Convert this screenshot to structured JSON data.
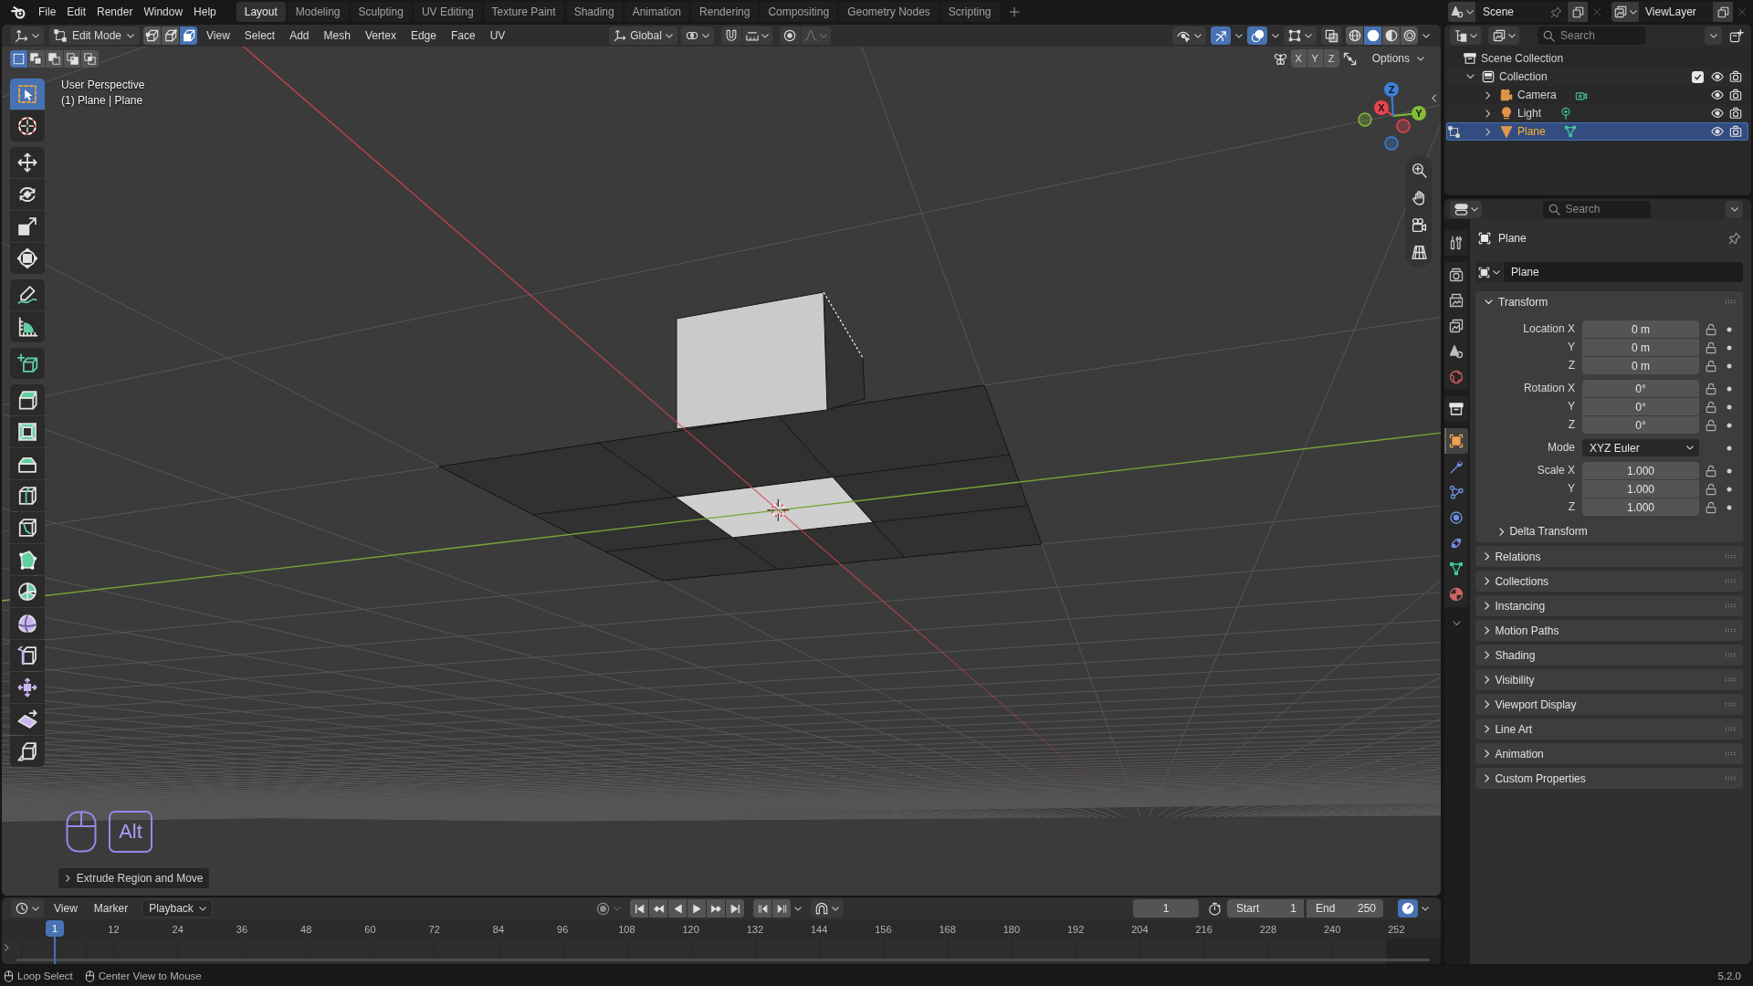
{
  "topbar": {
    "menus": [
      "File",
      "Edit",
      "Render",
      "Window",
      "Help"
    ],
    "workspaces": [
      {
        "label": "Layout",
        "selected": true
      },
      {
        "label": "Modeling",
        "selected": false
      },
      {
        "label": "Sculpting",
        "selected": false
      },
      {
        "label": "UV Editing",
        "selected": false
      },
      {
        "label": "Texture Paint",
        "selected": false
      },
      {
        "label": "Shading",
        "selected": false
      },
      {
        "label": "Animation",
        "selected": false
      },
      {
        "label": "Rendering",
        "selected": false
      },
      {
        "label": "Compositing",
        "selected": false
      },
      {
        "label": "Geometry Nodes",
        "selected": false
      },
      {
        "label": "Scripting",
        "selected": false
      }
    ],
    "scene": "Scene",
    "view_layer": "ViewLayer"
  },
  "viewport": {
    "header": {
      "mode": "Edit Mode",
      "select_modes": [
        {
          "kind": "vertex",
          "selected": false
        },
        {
          "kind": "edge",
          "selected": false
        },
        {
          "kind": "face",
          "selected": true
        }
      ],
      "menus": [
        "View",
        "Select",
        "Add",
        "Mesh",
        "Vertex",
        "Edge",
        "Face",
        "UV"
      ],
      "orientation": "Global",
      "toggles": [
        {
          "kind": "gizmo",
          "on": true
        },
        {
          "kind": "overlay",
          "on": true
        },
        {
          "kind": "xray",
          "on": false
        }
      ],
      "shading": [
        {
          "kind": "wireframe",
          "selected": false
        },
        {
          "kind": "solid",
          "selected": true
        },
        {
          "kind": "material",
          "selected": false
        },
        {
          "kind": "rendered",
          "selected": false
        }
      ]
    },
    "tool_settings": {
      "selection_ops": [
        {
          "kind": "set",
          "selected": true
        },
        {
          "kind": "extend",
          "selected": false
        },
        {
          "kind": "subtract",
          "selected": false
        },
        {
          "kind": "invert",
          "selected": false
        },
        {
          "kind": "intersect",
          "selected": false
        }
      ],
      "mirror": [
        {
          "label": "X",
          "on": false
        },
        {
          "label": "Y",
          "on": false
        },
        {
          "label": "Z",
          "on": false
        }
      ],
      "options": "Options"
    },
    "overlay_text": [
      "User Perspective",
      "(1) Plane | Plane"
    ],
    "toolbar": [
      {
        "tools": [
          {
            "kind": "select",
            "selected": true
          },
          {
            "kind": "cursor",
            "selected": false
          }
        ]
      },
      {
        "tools": [
          {
            "kind": "move",
            "selected": false
          },
          {
            "kind": "rotate",
            "selected": false
          },
          {
            "kind": "scale",
            "selected": false
          },
          {
            "kind": "transform",
            "selected": false
          }
        ]
      },
      {
        "tools": [
          {
            "kind": "annotate",
            "selected": false
          },
          {
            "kind": "measure",
            "selected": false
          }
        ]
      },
      {
        "tools": [
          {
            "kind": "addcube",
            "selected": false
          }
        ]
      },
      {
        "tools": [
          {
            "kind": "extrude",
            "selected": false
          },
          {
            "kind": "inset",
            "selected": false
          },
          {
            "kind": "bevel",
            "selected": false
          },
          {
            "kind": "loopcut",
            "selected": false
          },
          {
            "kind": "knife",
            "selected": false
          },
          {
            "kind": "polybuild",
            "selected": false
          },
          {
            "kind": "spin",
            "selected": false
          },
          {
            "kind": "smooth",
            "selected": false
          },
          {
            "kind": "slide",
            "selected": false
          },
          {
            "kind": "shrink",
            "selected": false
          },
          {
            "kind": "shear",
            "selected": false
          },
          {
            "kind": "rip",
            "selected": false
          }
        ]
      }
    ],
    "gizmo_axes": [
      {
        "label": "X",
        "color": "#e8434f"
      },
      {
        "label": "Y",
        "color": "#84bd38"
      },
      {
        "label": "Z",
        "color": "#3d7fdd"
      }
    ],
    "input_hint": {
      "key": "Alt"
    },
    "last_operator": {
      "label": "Extrude Region and Move",
      "expanded": false
    }
  },
  "timeline": {
    "menus": [
      "View",
      "Marker"
    ],
    "playback": "Playback",
    "auto_keying": false,
    "current_frame": "1",
    "start": {
      "label": "Start",
      "value": "1"
    },
    "end": {
      "label": "End",
      "value": "250"
    },
    "playhead": "1",
    "ruler": [
      "12",
      "24",
      "36",
      "48",
      "60",
      "72",
      "84",
      "96",
      "108",
      "120",
      "132",
      "144",
      "156",
      "168",
      "180",
      "192",
      "204",
      "216",
      "228",
      "240",
      "252"
    ]
  },
  "outliner": {
    "search": {
      "placeholder": "Search"
    },
    "tree": [
      {
        "label": "Scene Collection",
        "kind": "scene",
        "selected": false,
        "children": [
          {
            "label": "Collection",
            "kind": "collection",
            "selected": false,
            "expanded": true,
            "checked": true,
            "visible": true,
            "renderable": true,
            "children": [
              {
                "label": "Camera",
                "kind": "camera",
                "selected": false,
                "expanded": false,
                "editing": false,
                "visible": true,
                "renderable": true
              },
              {
                "label": "Light",
                "kind": "light",
                "selected": false,
                "expanded": false,
                "editing": false,
                "visible": true,
                "renderable": true
              },
              {
                "label": "Plane",
                "kind": "mesh",
                "selected": true,
                "expanded": false,
                "editing": true,
                "visible": true,
                "renderable": true
              }
            ]
          }
        ]
      }
    ]
  },
  "properties": {
    "search": {
      "placeholder": "Search"
    },
    "tab_groups": [
      {
        "tabs": [
          {
            "kind": "tool",
            "selected": false
          }
        ]
      },
      {
        "tabs": [
          {
            "kind": "render",
            "selected": false
          },
          {
            "kind": "output",
            "selected": false
          },
          {
            "kind": "viewlayer",
            "selected": false
          },
          {
            "kind": "scene",
            "selected": false
          },
          {
            "kind": "world",
            "selected": false
          }
        ]
      },
      {
        "tabs": [
          {
            "kind": "collection",
            "selected": false
          }
        ]
      },
      {
        "tabs": [
          {
            "kind": "object",
            "selected": true
          },
          {
            "kind": "modifiers",
            "selected": false
          },
          {
            "kind": "particles",
            "selected": false
          },
          {
            "kind": "physics",
            "selected": false
          },
          {
            "kind": "constraints",
            "selected": false
          },
          {
            "kind": "data",
            "selected": false
          },
          {
            "kind": "material",
            "selected": false
          }
        ]
      }
    ],
    "context": "Plane",
    "object_name": "Plane",
    "transform": {
      "label": "Transform",
      "expanded": true,
      "groups": [
        {
          "rows": [
            {
              "kind": "number",
              "label": "Location X",
              "value": "0 m",
              "locked": false
            },
            {
              "kind": "number",
              "label": "Y",
              "value": "0 m",
              "locked": false
            },
            {
              "kind": "number",
              "label": "Z",
              "value": "0 m",
              "locked": false
            }
          ]
        },
        {
          "rows": [
            {
              "kind": "number",
              "label": "Rotation X",
              "value": "0°",
              "locked": false
            },
            {
              "kind": "number",
              "label": "Y",
              "value": "0°",
              "locked": false
            },
            {
              "kind": "number",
              "label": "Z",
              "value": "0°",
              "locked": false
            }
          ]
        },
        {
          "rows": [
            {
              "kind": "dropdown",
              "label": "Mode",
              "value": "XYZ Euler"
            }
          ]
        },
        {
          "rows": [
            {
              "kind": "number",
              "label": "Scale X",
              "value": "1.000",
              "locked": false
            },
            {
              "kind": "number",
              "label": "Y",
              "value": "1.000",
              "locked": false
            },
            {
              "kind": "number",
              "label": "Z",
              "value": "1.000",
              "locked": false
            }
          ]
        }
      ],
      "subpanels": [
        {
          "label": "Delta Transform",
          "expanded": false
        }
      ]
    },
    "panels": [
      {
        "label": "Relations",
        "expanded": false
      },
      {
        "label": "Collections",
        "expanded": false
      },
      {
        "label": "Instancing",
        "expanded": false
      },
      {
        "label": "Motion Paths",
        "expanded": false
      },
      {
        "label": "Shading",
        "expanded": false
      },
      {
        "label": "Visibility",
        "expanded": false
      },
      {
        "label": "Viewport Display",
        "expanded": false
      },
      {
        "label": "Line Art",
        "expanded": false
      },
      {
        "label": "Animation",
        "expanded": false
      },
      {
        "label": "Custom Properties",
        "expanded": false
      }
    ]
  },
  "status_bar": {
    "hints": [
      "Loop Select",
      "Center View to Mouse"
    ],
    "version": "5.2.0"
  }
}
